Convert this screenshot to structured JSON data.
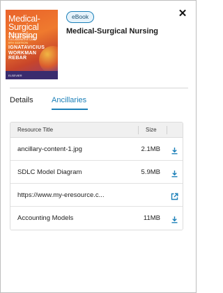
{
  "book": {
    "badge": "eBook",
    "title": "Medical-Surgical Nursing",
    "cover": {
      "title_line1": "Medical-",
      "title_line2": "Surgical",
      "title_line3": "Nursing",
      "subtitle": "CONCEPTS FOR INTERPROFESSIONAL COLLABORATIVE CARE",
      "edition": "9TH EDITION",
      "author1": "IGNATAVICIUS",
      "author2": "WORKMAN",
      "author3": "REBAR",
      "publisher": "ELSEVIER"
    }
  },
  "tabs": {
    "details": "Details",
    "ancillaries": "Ancillaries"
  },
  "table": {
    "headers": {
      "title": "Resource Title",
      "size": "Size"
    },
    "rows": [
      {
        "title": "ancillary-content-1.jpg",
        "size": "2.1MB",
        "action": "download-icon"
      },
      {
        "title": "SDLC Model Diagram",
        "size": "5.9MB",
        "action": "download-icon"
      },
      {
        "title": "https://www.my-eresource.c...",
        "size": "",
        "action": "external-link-icon"
      },
      {
        "title": "Accounting Models",
        "size": "11MB",
        "action": "download-icon"
      }
    ]
  },
  "colors": {
    "accent": "#1a7fb8",
    "badge_bg": "#e6f3fb"
  }
}
